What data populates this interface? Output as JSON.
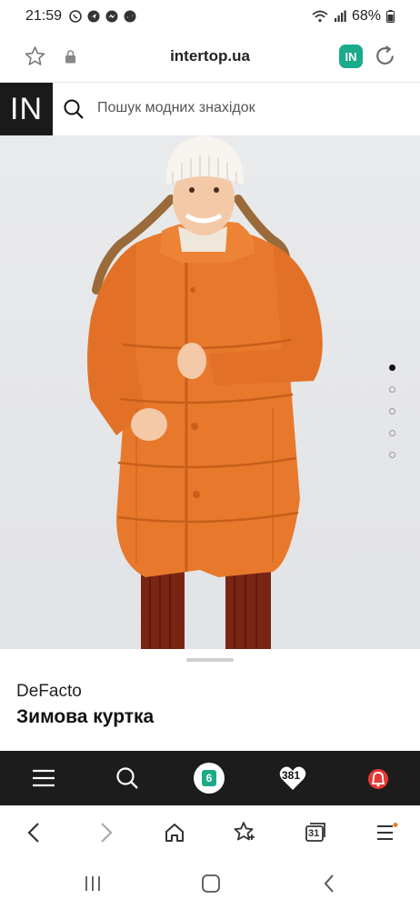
{
  "status_bar": {
    "time": "21:59",
    "battery": "68%",
    "notification_icons": [
      "viber-icon",
      "location-icon",
      "messenger-icon",
      "messenger-icon",
      "dot-icon"
    ],
    "right_icons": [
      "wifi-icon",
      "signal-icon",
      "battery-icon"
    ]
  },
  "browser_top": {
    "url": "intertop.ua",
    "left_icons": [
      "star-icon",
      "lock-icon"
    ],
    "right_icons": [
      "site-app-icon",
      "reload-icon"
    ],
    "site_icon_text": "IN",
    "site_icon_color": "#1bab8a"
  },
  "site_header": {
    "logo_text": "IN",
    "search_placeholder": "Пошук модних знахідок"
  },
  "gallery": {
    "slides": 5,
    "active_slide": 1
  },
  "product": {
    "brand": "DeFacto",
    "title": "Зимова куртка"
  },
  "app_nav": {
    "cart_count": "6",
    "favorites_count": "381",
    "items": [
      "menu-icon",
      "search-icon",
      "cart-icon",
      "favorites-icon",
      "notifications-icon"
    ],
    "accent": "#1bab8a",
    "alert_color": "#e53935"
  },
  "browser_nav": {
    "tabs_count": "31",
    "items": [
      "back-icon",
      "forward-icon",
      "home-icon",
      "bookmarks-icon",
      "tabs-icon",
      "browser-menu-icon"
    ]
  },
  "system_nav": {
    "items": [
      "recents-icon",
      "home-button-icon",
      "back-button-icon"
    ]
  }
}
